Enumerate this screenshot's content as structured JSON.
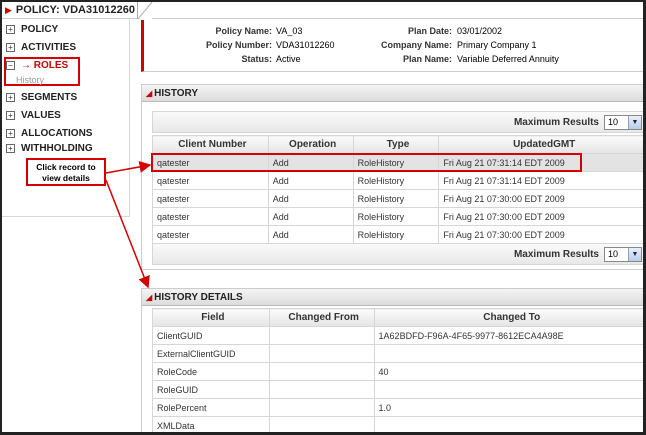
{
  "policy_tab": {
    "title": "POLICY: VDA31012260"
  },
  "nav": {
    "items": [
      {
        "box": "+",
        "label": "POLICY"
      },
      {
        "box": "+",
        "label": "ACTIVITIES"
      },
      {
        "box": "−",
        "label": "→ ROLES",
        "active": true
      },
      {
        "box": "+",
        "label": "SEGMENTS"
      },
      {
        "box": "+",
        "label": "VALUES"
      },
      {
        "box": "+",
        "label": "ALLOCATIONS"
      },
      {
        "box": "+",
        "label": "WITHHOLDING"
      }
    ],
    "sub_item": "History"
  },
  "callout": {
    "text": "Click record to view details"
  },
  "info": {
    "policy_name_label": "Policy Name:",
    "policy_name": "VA_03",
    "policy_number_label": "Policy Number:",
    "policy_number": "VDA31012260",
    "status_label": "Status:",
    "status": "Active",
    "plan_date_label": "Plan Date:",
    "plan_date": "03/01/2002",
    "company_name_label": "Company Name:",
    "company_name": "Primary Company 1",
    "plan_name_label": "Plan Name:",
    "plan_name": "Variable Deferred Annuity"
  },
  "history": {
    "title": "HISTORY",
    "max_results_label": "Maximum Results",
    "max_results_value": "10",
    "columns": [
      "Client Number",
      "Operation",
      "Type",
      "UpdatedGMT"
    ],
    "rows": [
      [
        "qatester",
        "Add",
        "RoleHistory",
        "Fri Aug 21 07:31:14 EDT 2009"
      ],
      [
        "qatester",
        "Add",
        "RoleHistory",
        "Fri Aug 21 07:31:14 EDT 2009"
      ],
      [
        "qatester",
        "Add",
        "RoleHistory",
        "Fri Aug 21 07:30:00 EDT 2009"
      ],
      [
        "qatester",
        "Add",
        "RoleHistory",
        "Fri Aug 21 07:30:00 EDT 2009"
      ],
      [
        "qatester",
        "Add",
        "RoleHistory",
        "Fri Aug 21 07:30:00 EDT 2009"
      ]
    ]
  },
  "details": {
    "title": "HISTORY DETAILS",
    "columns": [
      "Field",
      "Changed From",
      "Changed To"
    ],
    "rows": [
      [
        "ClientGUID",
        "",
        "1A62BDFD-F96A-4F65-9977-8612ECA4A98E"
      ],
      [
        "ExternalClientGUID",
        "",
        ""
      ],
      [
        "RoleCode",
        "",
        "40"
      ],
      [
        "RoleGUID",
        "",
        ""
      ],
      [
        "RolePercent",
        "",
        "1.0"
      ],
      [
        "XMLData",
        "",
        ""
      ]
    ]
  },
  "colors": {
    "accent": "#cc0000",
    "outline": "#d40000"
  }
}
